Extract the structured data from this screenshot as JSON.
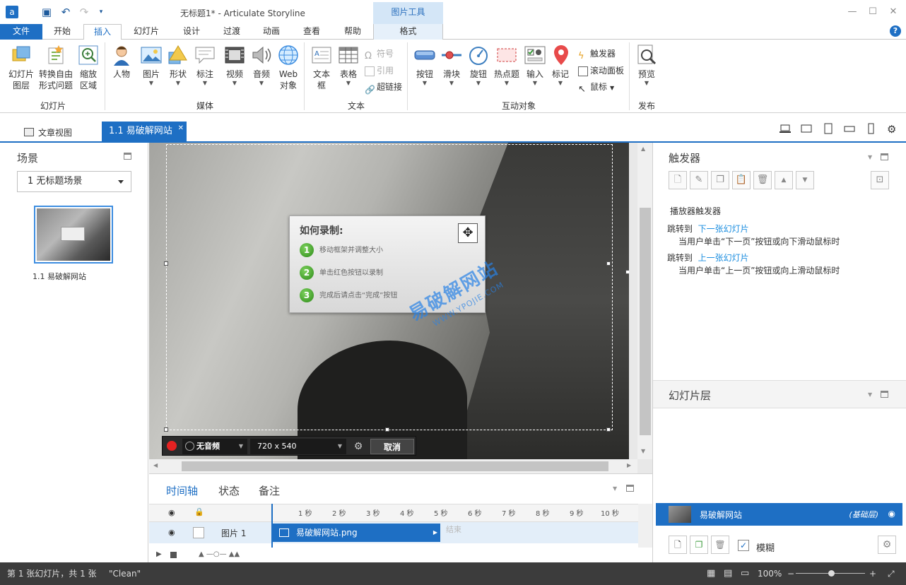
{
  "titlebar": {
    "title": "无标题1* -  Articulate Storyline",
    "context_tool": "图片工具"
  },
  "tabs": [
    {
      "label": "文件"
    },
    {
      "label": "开始"
    },
    {
      "label": "插入"
    },
    {
      "label": "幻灯片"
    },
    {
      "label": "设计"
    },
    {
      "label": "过渡"
    },
    {
      "label": "动画"
    },
    {
      "label": "查看"
    },
    {
      "label": "帮助"
    },
    {
      "label": "格式"
    }
  ],
  "ribbon": {
    "slide_layers": "幻灯片图层",
    "convert_freeform": "转换自由形式问题",
    "zoom_region": "缩放区域",
    "group_slides": "幻灯片",
    "character": "人物",
    "picture": "图片",
    "shape": "形状",
    "caption": "标注",
    "video": "视频",
    "audio": "音频",
    "web_object": "Web对象",
    "group_media": "媒体",
    "textbox": "文本框",
    "table": "表格",
    "symbol": "符号",
    "reference": "引用",
    "hyperlink": "超链接",
    "group_text": "文本",
    "button": "按钮",
    "slider": "滑块",
    "dial": "旋钮",
    "hotspot": "热点题",
    "input": "输入",
    "marker": "标记",
    "trigger": "触发器",
    "scroll_panel": "滚动面板",
    "mouse": "鼠标",
    "group_interactive": "互动对象",
    "preview": "预览",
    "group_publish": "发布"
  },
  "doctabs": {
    "story_view": "文章视图",
    "slide_tab": "1.1 易破解网站"
  },
  "scenes": {
    "title": "场景",
    "selected": "1 无标题场景",
    "thumb_label": "1.1 易破解网站"
  },
  "howto": {
    "title": "如何录制:",
    "steps": [
      {
        "num": "1",
        "text": "移动框架并调整大小"
      },
      {
        "num": "2",
        "text": "单击红色按钮以录制"
      },
      {
        "num": "3",
        "text": "完成后请点击“完成”按钮"
      }
    ]
  },
  "watermark": {
    "main": "易破解网站",
    "sub": "WWW.YPOJIE.COM"
  },
  "recorder": {
    "audio": "无音频",
    "size": "720 x 540",
    "cancel": "取消"
  },
  "timeline": {
    "tabs": [
      "时间轴",
      "状态",
      "备注"
    ],
    "ticks": [
      "1 秒",
      "2 秒",
      "3 秒",
      "4 秒",
      "5 秒",
      "6 秒",
      "7 秒",
      "8 秒",
      "9 秒",
      "10 秒"
    ],
    "row_name": "图片 1",
    "bar_label": "易破解网站.png",
    "end_label": "结束"
  },
  "triggers": {
    "title": "触发器",
    "player_triggers": "播放器触发器",
    "items": [
      {
        "action": "跳转到",
        "target": "下一张幻灯片",
        "condition": "当用户单击“下一页”按钮或向下滑动鼠标时"
      },
      {
        "action": "跳转到",
        "target": "上一张幻灯片",
        "condition": "当用户单击“上一页”按钮或向上滑动鼠标时"
      }
    ]
  },
  "layers": {
    "title": "幻灯片层",
    "base_name": "易破解网站",
    "base_tag": "(基础层)",
    "blur": "模糊"
  },
  "status": {
    "slide_info": "第 1 张幻灯片，共 1 张",
    "theme": "\"Clean\"",
    "zoom": "100%"
  }
}
